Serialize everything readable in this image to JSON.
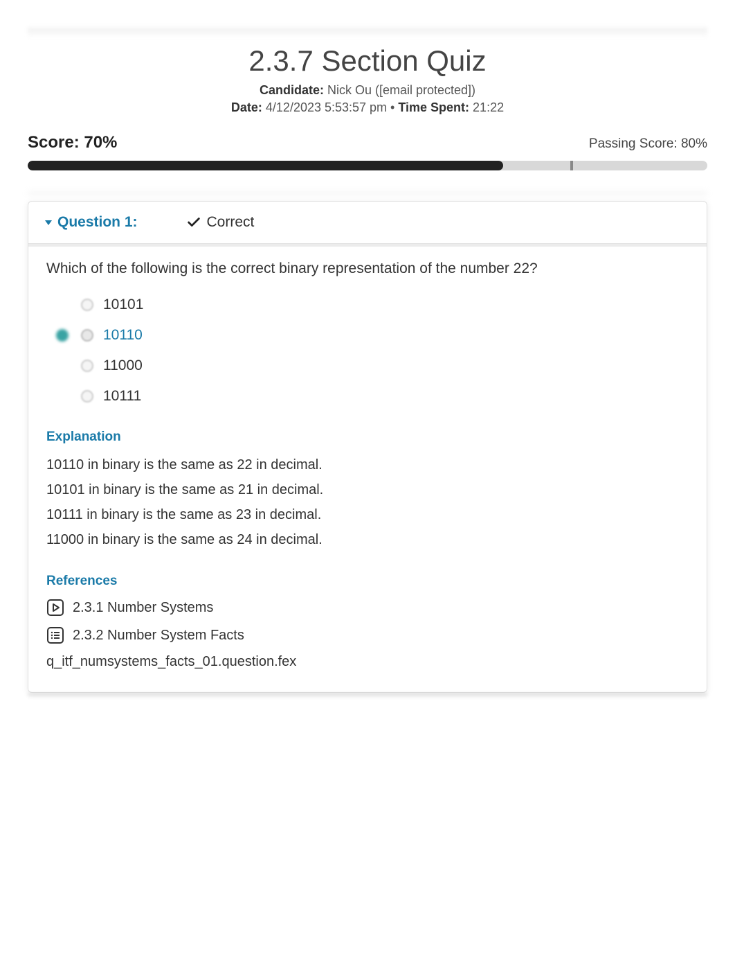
{
  "title": "2.3.7 Section Quiz",
  "candidate_label": "Candidate:",
  "candidate_value": " Nick Ou ([email protected])",
  "date_label": "Date:",
  "date_value": " 4/12/2023 5:53:57 pm",
  "separator": " • ",
  "time_label": "Time Spent:",
  "time_value": " 21:22",
  "score_label": "Score: 70%",
  "passing_label": "Passing Score: 80%",
  "question": {
    "header": "Question 1:",
    "status": "Correct",
    "prompt": "Which of the following is the correct binary representation of the number 22?",
    "options": [
      {
        "label": "10101",
        "correct": false
      },
      {
        "label": "10110",
        "correct": true
      },
      {
        "label": "11000",
        "correct": false
      },
      {
        "label": "10111",
        "correct": false
      }
    ],
    "explanation_heading": "Explanation",
    "explanation_lines": [
      "10110 in binary is the same as 22 in decimal.",
      "10101 in binary is the same as 21 in decimal.",
      "10111 in binary is the same as 23 in decimal.",
      "11000 in binary is the same as 24 in decimal."
    ],
    "references_heading": "References",
    "references": [
      {
        "icon": "video",
        "label": "2.3.1 Number Systems"
      },
      {
        "icon": "list",
        "label": "2.3.2 Number System Facts"
      }
    ],
    "file": "q_itf_numsystems_facts_01.question.fex"
  }
}
